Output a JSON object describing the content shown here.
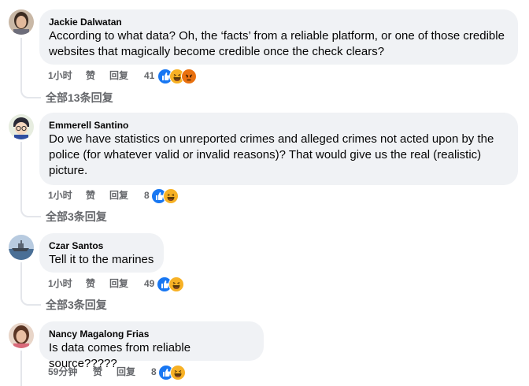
{
  "comments": [
    {
      "author": "Jackie Dalwatan",
      "text_lines": [
        "According to what data? Oh, the ‘facts’ from a reliable platform, or one of those credible",
        "websites that magically become credible once the check clears?"
      ],
      "time": "1小时",
      "like_label": "赞",
      "reply_label": "回复",
      "reaction_count": "41",
      "reactions": [
        "like-icon",
        "haha-icon",
        "angry-icon"
      ],
      "view_replies": "全部13条回复"
    },
    {
      "author": "Emmerell Santino",
      "text_lines": [
        "Do we have statistics on unreported crimes and alleged crimes not acted upon by the",
        "police (for whatever valid or invalid reasons)? That would give us the real (realistic)",
        "picture."
      ],
      "time": "1小时",
      "like_label": "赞",
      "reply_label": "回复",
      "reaction_count": "8",
      "reactions": [
        "like-icon",
        "haha-icon"
      ],
      "view_replies": "全部3条回复"
    },
    {
      "author": "Czar Santos",
      "text_lines": [
        "Tell it to the marines"
      ],
      "time": "1小时",
      "like_label": "赞",
      "reply_label": "回复",
      "reaction_count": "49",
      "reactions": [
        "like-icon",
        "haha-icon"
      ],
      "view_replies": "全部3条回复"
    },
    {
      "author": "Nancy Magalong Frias",
      "text_lines": [
        "Is data comes from reliable source?????"
      ],
      "time": "59分钟",
      "like_label": "赞",
      "reply_label": "回复",
      "reaction_count": "8",
      "reactions": [
        "like-icon",
        "haha-icon"
      ]
    }
  ],
  "colors": {
    "bubble": "#f0f2f5",
    "secondary_text": "#65676b",
    "like_blue": "#1877f2",
    "haha_yellow": "#f7b125",
    "angry_orange": "#e9710f"
  }
}
